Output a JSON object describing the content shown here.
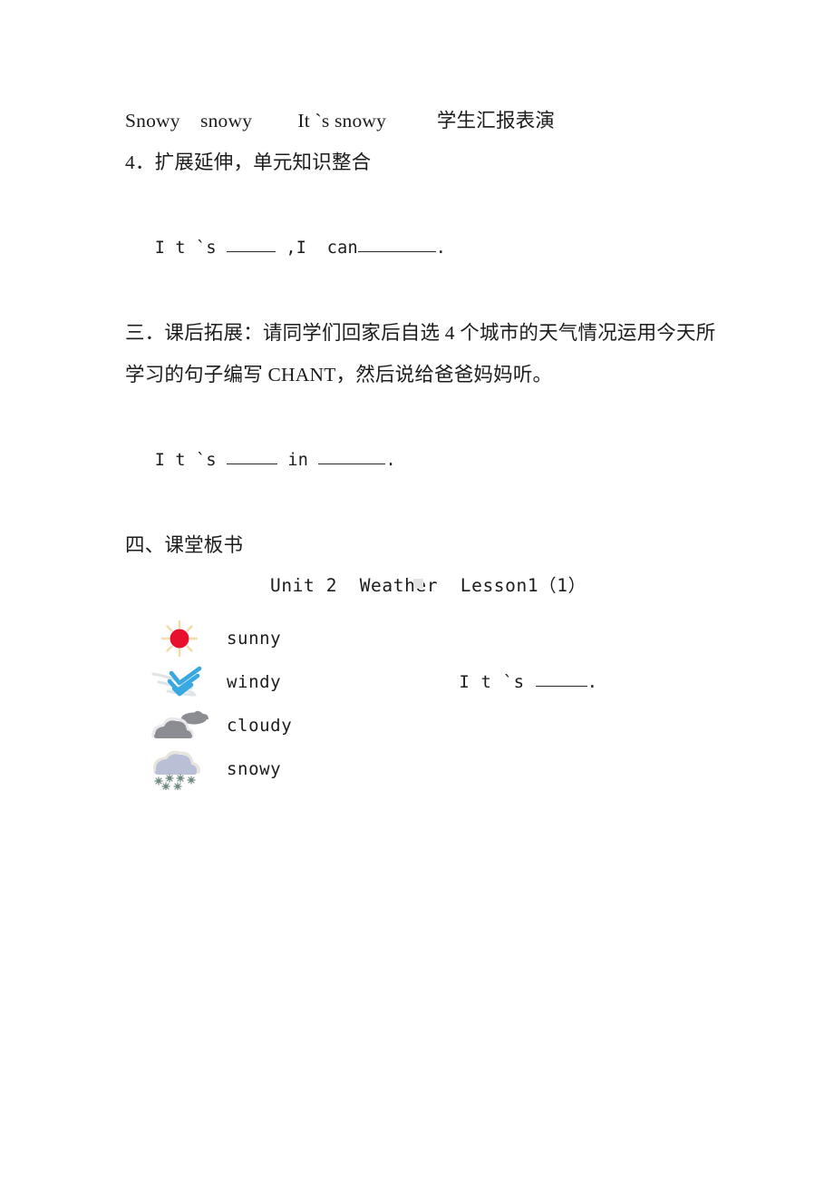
{
  "document": {
    "lines": [
      {
        "id": "line-snowy-drill",
        "text": "Snowy    snowy         It `s snowy          学生汇报表演"
      },
      {
        "id": "line-section-4",
        "text": "4．扩展延伸，单元知识整合"
      },
      {
        "id": "line-section-3-heading",
        "text": "三．课后拓展：请同学们回家后自选 4 个城市的天气情况运用今天所"
      },
      {
        "id": "line-section-3-continued",
        "text": "学习的句子编写 CHANT，然后说给爸爸妈妈听。"
      },
      {
        "id": "line-section-4-heading",
        "text": "四、课堂板书"
      }
    ],
    "fill_in_1": {
      "prefix": "I t `s ",
      "middle": " ,I  can",
      "suffix": "."
    },
    "fill_in_2": {
      "prefix": "I t `s ",
      "middle": " in ",
      "suffix": "."
    },
    "board": {
      "title": "Unit 2  Weather  Lesson1（1）",
      "sentence_pattern": {
        "prefix": "I t `s ",
        "suffix": "."
      },
      "items": [
        {
          "icon": "sun-icon",
          "label": "sunny"
        },
        {
          "icon": "wind-icon",
          "label": "windy"
        },
        {
          "icon": "cloud-icon",
          "label": "cloudy"
        },
        {
          "icon": "snow-cloud-icon",
          "label": "snowy"
        }
      ]
    }
  },
  "colors": {
    "sun_disc": "#e8112d",
    "sun_rays": "#f0dca8",
    "wind_stroke": "#38a8e0",
    "wind_trail": "#dfe4e8",
    "cloud_gray": "#8c8c93",
    "cloud_gray_light": "#e9e9ec",
    "snow_cloud": "#b9c0d6",
    "snow_cloud_edge": "#e7e4dc",
    "snowflake": "#6f8a83",
    "text": "#1c1c1c",
    "page_bg": "#ffffff",
    "artifact": "#e3e3e3"
  }
}
